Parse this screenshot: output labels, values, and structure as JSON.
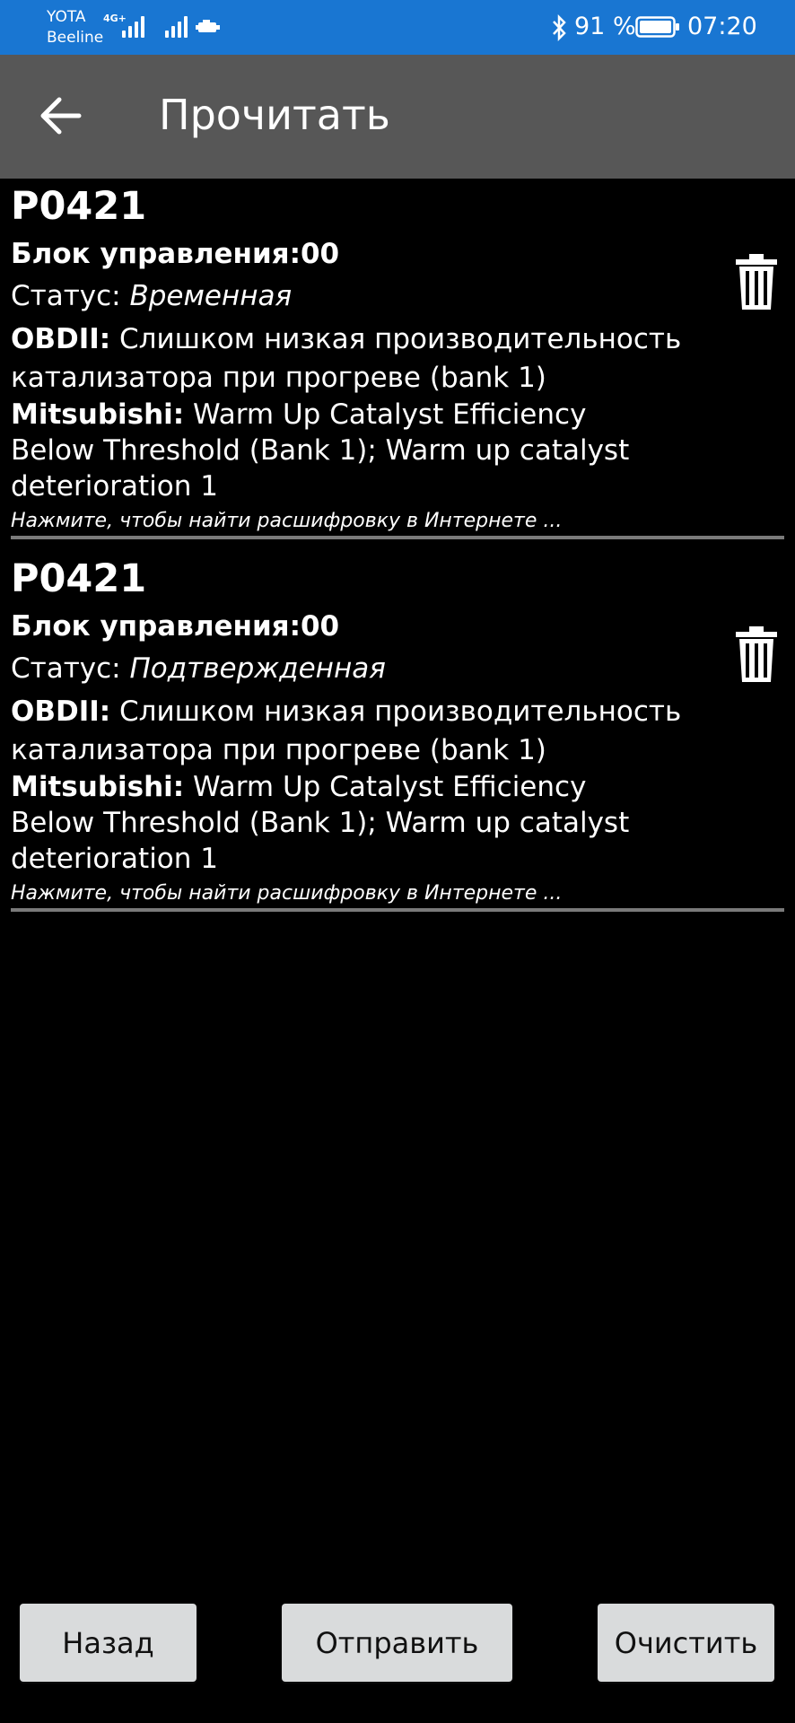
{
  "status_bar": {
    "carrier1": "YOTA",
    "carrier2": "Beeline",
    "net_type": "4G+",
    "battery": "91 %",
    "time": "07:20",
    "bg_color": "#1976d2"
  },
  "app_bar": {
    "title": "Прочитать",
    "back_icon": "arrow-left-icon",
    "bg_color": "#575757"
  },
  "dtcs": [
    {
      "code": "P0421",
      "block": "Блок управления:00",
      "status_label": "Статус: ",
      "status_value": "Временная",
      "obd_label": "OBDII:",
      "obd_text_1": " Слишком низкая производительность",
      "obd_text_2": "катализатора при прогреве (bank 1)",
      "mfr_label": "Mitsubishi:",
      "mfr_text_1": " Warm Up Catalyst Efficiency",
      "mfr_text_2": "Below Threshold (Bank 1); Warm up catalyst",
      "mfr_text_3": "deterioration 1",
      "hint": "Нажмите, чтобы найти расшифровку в Интернете ..."
    },
    {
      "code": "P0421",
      "block": "Блок управления:00",
      "status_label": "Статус: ",
      "status_value": "Подтвержденная",
      "obd_label": "OBDII:",
      "obd_text_1": " Слишком низкая производительность",
      "obd_text_2": "катализатора при прогреве (bank 1)",
      "mfr_label": "Mitsubishi:",
      "mfr_text_1": " Warm Up Catalyst Efficiency",
      "mfr_text_2": "Below Threshold (Bank 1); Warm up catalyst",
      "mfr_text_3": "deterioration 1",
      "hint": "Нажмите, чтобы найти расшифровку в Интернете ..."
    }
  ],
  "buttons": {
    "back": "Назад",
    "send": "Отправить",
    "clear": "Очистить"
  }
}
